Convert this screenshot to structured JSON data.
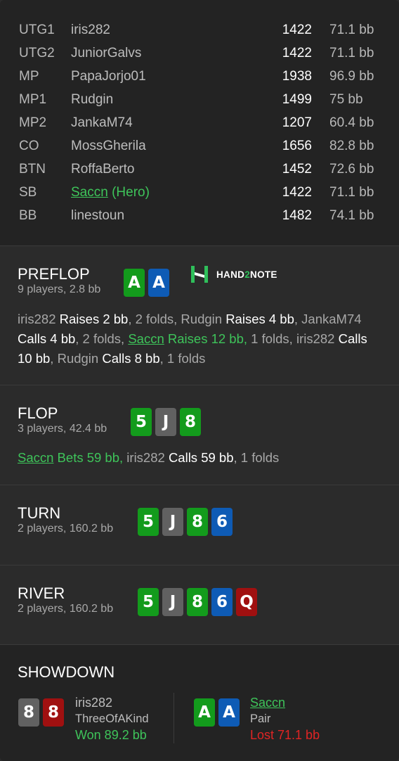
{
  "players": [
    {
      "pos": "UTG1",
      "name": "iris282",
      "chips": "1422",
      "bb": "71.1 bb",
      "hero": false
    },
    {
      "pos": "UTG2",
      "name": "JuniorGalvs",
      "chips": "1422",
      "bb": "71.1 bb",
      "hero": false
    },
    {
      "pos": "MP",
      "name": "PapaJorjo01",
      "chips": "1938",
      "bb": "96.9 bb",
      "hero": false
    },
    {
      "pos": "MP1",
      "name": "Rudgin",
      "chips": "1499",
      "bb": "75 bb",
      "hero": false
    },
    {
      "pos": "MP2",
      "name": "JankaM74",
      "chips": "1207",
      "bb": "60.4 bb",
      "hero": false
    },
    {
      "pos": "CO",
      "name": "MossGherila",
      "chips": "1656",
      "bb": "82.8 bb",
      "hero": false
    },
    {
      "pos": "BTN",
      "name": "RoffaBerto",
      "chips": "1452",
      "bb": "72.6 bb",
      "hero": false
    },
    {
      "pos": "SB",
      "name": "Saccn",
      "hero_suffix": " (Hero)",
      "chips": "1422",
      "bb": "71.1 bb",
      "hero": true
    },
    {
      "pos": "BB",
      "name": "linestoun",
      "chips": "1482",
      "bb": "74.1 bb",
      "hero": false
    }
  ],
  "logo": {
    "icon": "hand2note-logo-icon",
    "text_a": "HAND",
    "text_b": "2",
    "text_c": "NOTE"
  },
  "preflop": {
    "title": "PREFLOP",
    "sub": "9 players, 2.8 bb",
    "cards": [
      {
        "rank": "A",
        "color": "green"
      },
      {
        "rank": "A",
        "color": "blue"
      }
    ],
    "actions": [
      {
        "t": "iris282 ",
        "k": "n"
      },
      {
        "t": "Raises 2 bb",
        "k": "a"
      },
      {
        "t": ", 2 folds, ",
        "k": "n"
      },
      {
        "t": "Rudgin ",
        "k": "n"
      },
      {
        "t": "Raises 4 bb",
        "k": "a"
      },
      {
        "t": ", ",
        "k": "n"
      },
      {
        "t": "JankaM74 ",
        "k": "n"
      },
      {
        "t": "Calls 4 bb",
        "k": "a"
      },
      {
        "t": ", 2 folds, ",
        "k": "n"
      },
      {
        "t": "Saccn",
        "k": "hn"
      },
      {
        "t": " Raises 12 bb,",
        "k": "ha"
      },
      {
        "t": " 1 folds, ",
        "k": "n"
      },
      {
        "t": "iris282 ",
        "k": "n"
      },
      {
        "t": "Calls 10 bb",
        "k": "a"
      },
      {
        "t": ", ",
        "k": "n"
      },
      {
        "t": "Rudgin ",
        "k": "n"
      },
      {
        "t": "Calls 8 bb",
        "k": "a"
      },
      {
        "t": ", 1 folds",
        "k": "n"
      }
    ]
  },
  "flop": {
    "title": "FLOP",
    "sub": "3 players, 42.4 bb",
    "cards": [
      {
        "rank": "5",
        "color": "green"
      },
      {
        "rank": "J",
        "color": "gray"
      },
      {
        "rank": "8",
        "color": "green"
      }
    ],
    "actions": [
      {
        "t": "Saccn",
        "k": "hn"
      },
      {
        "t": " Bets 59 bb,",
        "k": "ha"
      },
      {
        "t": " iris282 ",
        "k": "n"
      },
      {
        "t": "Calls 59 bb",
        "k": "a"
      },
      {
        "t": ", 1 folds",
        "k": "n"
      }
    ]
  },
  "turn": {
    "title": "TURN",
    "sub": "2 players, 160.2 bb",
    "cards": [
      {
        "rank": "5",
        "color": "green"
      },
      {
        "rank": "J",
        "color": "gray"
      },
      {
        "rank": "8",
        "color": "green"
      },
      {
        "rank": "6",
        "color": "blue"
      }
    ]
  },
  "river": {
    "title": "RIVER",
    "sub": "2 players, 160.2 bb",
    "cards": [
      {
        "rank": "5",
        "color": "green"
      },
      {
        "rank": "J",
        "color": "gray"
      },
      {
        "rank": "8",
        "color": "green"
      },
      {
        "rank": "6",
        "color": "blue"
      },
      {
        "rank": "Q",
        "color": "red"
      }
    ]
  },
  "showdown": {
    "title": "SHOWDOWN",
    "left": {
      "name": "iris282",
      "hand": "ThreeOfAKind",
      "result": "Won 89.2 bb",
      "won": true,
      "cards": [
        {
          "rank": "8",
          "color": "gray"
        },
        {
          "rank": "8",
          "color": "red"
        }
      ]
    },
    "right": {
      "name": "Saccn",
      "hand": "Pair",
      "result": "Lost 71.1 bb",
      "won": false,
      "cards": [
        {
          "rank": "A",
          "color": "green"
        },
        {
          "rank": "A",
          "color": "blue"
        }
      ]
    }
  },
  "colors": {
    "green_card": "#139b1c",
    "blue_card": "#0e5bb5",
    "gray_card": "#616161",
    "red_card": "#a01010",
    "hero": "#3ec45a",
    "loss": "#e02424"
  }
}
